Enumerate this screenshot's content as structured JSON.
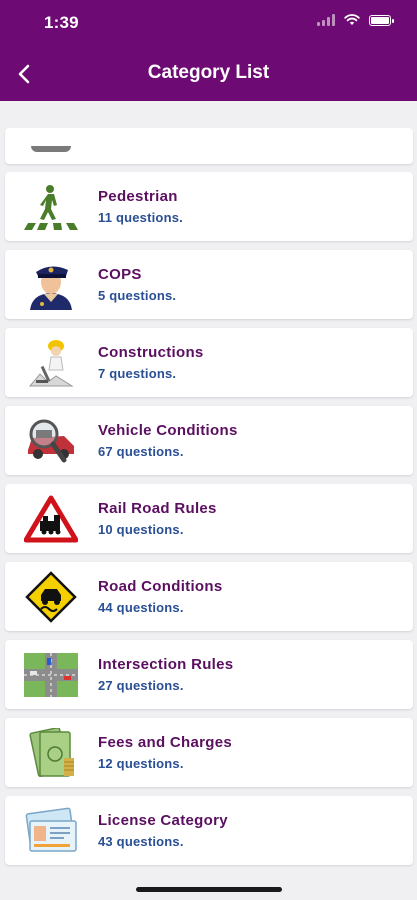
{
  "status": {
    "time": "1:39"
  },
  "header": {
    "title": "Category List"
  },
  "categories": [
    {
      "title": "Pedestrian",
      "count": "11 questions.",
      "icon": "pedestrian-crossing-icon"
    },
    {
      "title": "COPS",
      "count": "5 questions.",
      "icon": "police-officer-icon"
    },
    {
      "title": "Constructions",
      "count": "7 questions.",
      "icon": "construction-worker-icon"
    },
    {
      "title": "Vehicle Conditions",
      "count": "67 questions.",
      "icon": "car-inspection-icon"
    },
    {
      "title": "Rail Road Rules",
      "count": "10 questions.",
      "icon": "railroad-warning-sign-icon"
    },
    {
      "title": "Road Conditions",
      "count": "44 questions.",
      "icon": "slippery-road-sign-icon"
    },
    {
      "title": "Intersection Rules",
      "count": "27 questions.",
      "icon": "intersection-map-icon"
    },
    {
      "title": "Fees and Charges",
      "count": "12 questions.",
      "icon": "money-icon"
    },
    {
      "title": "License Category",
      "count": "43 questions.",
      "icon": "license-card-icon"
    }
  ],
  "colors": {
    "header": "#6e0a73",
    "title_text": "#5b0f60",
    "count_text": "#2a4f95"
  }
}
